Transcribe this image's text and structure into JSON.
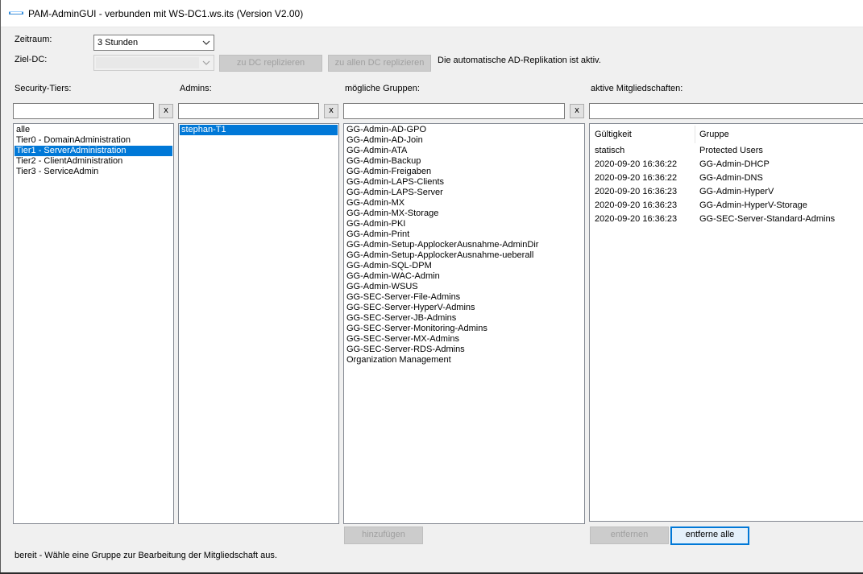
{
  "window": {
    "title": "PAM-AdminGUI - verbunden mit WS-DC1.ws.its (Version V2.00)"
  },
  "top": {
    "zeitraum_label": "Zeitraum:",
    "zeitraum_value": "3 Stunden",
    "ziel_dc_label": "Ziel-DC:",
    "ziel_dc_value": "",
    "replicate_dc_button": "zu DC replizieren",
    "replicate_all_button": "zu allen DC replizieren",
    "replication_info": "Die automatische AD-Replikation ist aktiv."
  },
  "columns": {
    "tiers_label": "Security-Tiers:",
    "admins_label": "Admins:",
    "groups_label": "mögliche Gruppen:",
    "memberships_label": "aktive Mitgliedschaften:",
    "clear_label": "x"
  },
  "tiers": [
    {
      "label": "alle",
      "selected": false
    },
    {
      "label": "Tier0 - DomainAdministration",
      "selected": false
    },
    {
      "label": "Tier1 - ServerAdministration",
      "selected": true
    },
    {
      "label": "Tier2 - ClientAdministration",
      "selected": false
    },
    {
      "label": "Tier3 - ServiceAdmin",
      "selected": false
    }
  ],
  "admins": [
    {
      "label": "stephan-T1",
      "selected": true
    }
  ],
  "groups": [
    "GG-Admin-AD-GPO",
    "GG-Admin-AD-Join",
    "GG-Admin-ATA",
    "GG-Admin-Backup",
    "GG-Admin-Freigaben",
    "GG-Admin-LAPS-Clients",
    "GG-Admin-LAPS-Server",
    "GG-Admin-MX",
    "GG-Admin-MX-Storage",
    "GG-Admin-PKI",
    "GG-Admin-Print",
    "GG-Admin-Setup-ApplockerAusnahme-AdminDir",
    "GG-Admin-Setup-ApplockerAusnahme-ueberall",
    "GG-Admin-SQL-DPM",
    "GG-Admin-WAC-Admin",
    "GG-Admin-WSUS",
    "GG-SEC-Server-File-Admins",
    "GG-SEC-Server-HyperV-Admins",
    "GG-SEC-Server-JB-Admins",
    "GG-SEC-Server-Monitoring-Admins",
    "GG-SEC-Server-MX-Admins",
    "GG-SEC-Server-RDS-Admins",
    "Organization Management"
  ],
  "memberships": {
    "header_validity": "Gültigkeit",
    "header_group": "Gruppe",
    "rows": [
      {
        "validity": "statisch",
        "group": "Protected Users"
      },
      {
        "validity": "2020-09-20 16:36:22",
        "group": "GG-Admin-DHCP"
      },
      {
        "validity": "2020-09-20 16:36:22",
        "group": "GG-Admin-DNS"
      },
      {
        "validity": "2020-09-20 16:36:23",
        "group": "GG-Admin-HyperV"
      },
      {
        "validity": "2020-09-20 16:36:23",
        "group": "GG-Admin-HyperV-Storage"
      },
      {
        "validity": "2020-09-20 16:36:23",
        "group": "GG-SEC-Server-Standard-Admins"
      }
    ]
  },
  "actions": {
    "add_button": "hinzufügen",
    "remove_button": "entfernen",
    "remove_all_button": "entferne alle"
  },
  "status_text": "bereit - Wähle eine Gruppe zur Bearbeitung der Mitgliedschaft aus.",
  "colors": {
    "selection": "#0078d7",
    "window_bg": "#f0f0f0"
  },
  "icons": {
    "app": "app-window-icon",
    "dropdown": "chevron-down-icon"
  }
}
